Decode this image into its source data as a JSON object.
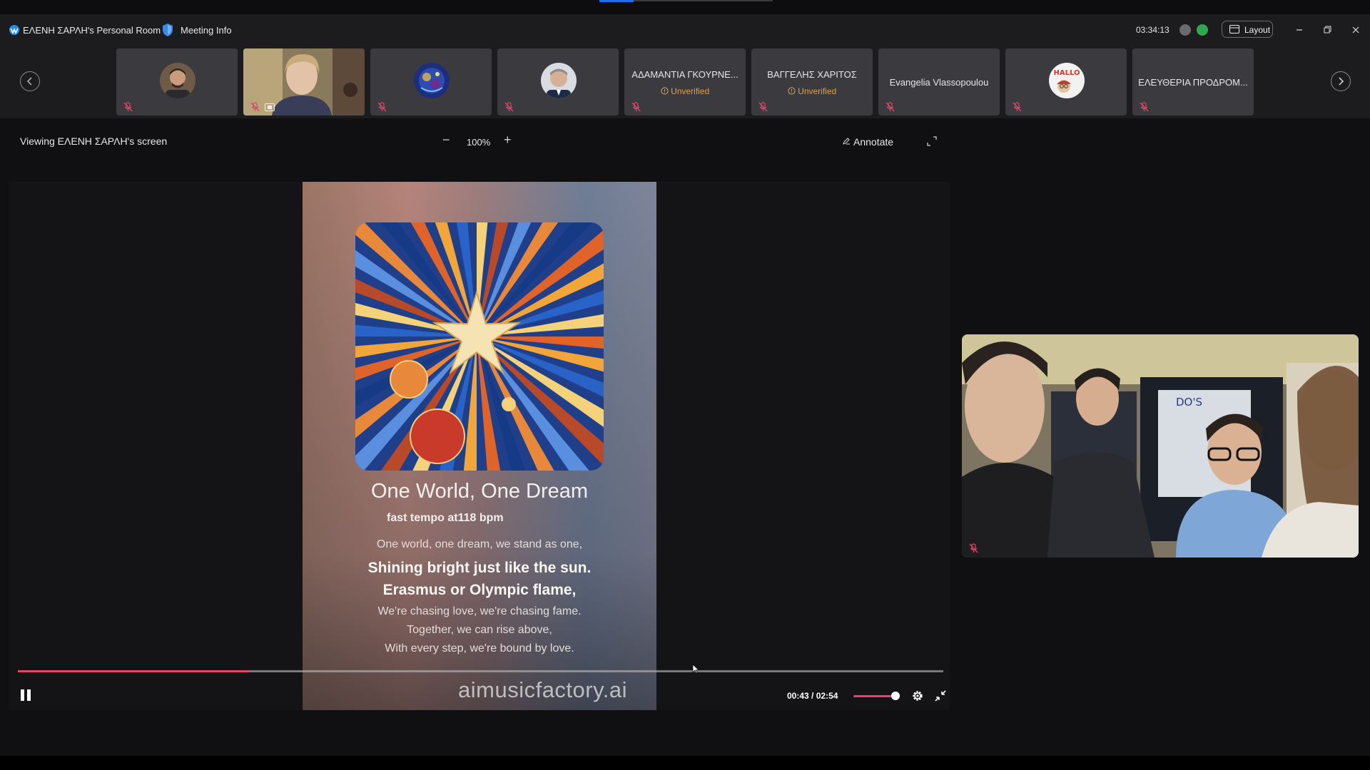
{
  "titlebar": {
    "room_title": "ΕΛΕΝΗ ΣΑΡΛΗ's Personal Room",
    "meeting_info": "Meeting Info",
    "clock": "03:34:13",
    "layout_label": "Layout"
  },
  "participants": [
    {
      "name": "",
      "unverified": "",
      "kind": "avatar-man"
    },
    {
      "name": "",
      "unverified": "",
      "kind": "video-woman"
    },
    {
      "name": "",
      "unverified": "",
      "kind": "avatar-space"
    },
    {
      "name": "",
      "unverified": "",
      "kind": "avatar-man2"
    },
    {
      "name": "ΑΔΑΜΑΝΤΙΑ ΓΚΟΥΡΝΕ...",
      "unverified": "Unverified",
      "kind": "name"
    },
    {
      "name": "ΒΑΓΓΕΛΗΣ ΧΑΡΙΤΟΣ",
      "unverified": "Unverified",
      "kind": "name"
    },
    {
      "name": "Evangelia Vlassopoulou",
      "unverified": "",
      "kind": "name"
    },
    {
      "name": "",
      "unverified": "",
      "kind": "avatar-hallo"
    },
    {
      "name": "ΕΛΕΥΘΕΡΙΑ ΠΡΟΔΡΟΜ...",
      "unverified": "",
      "kind": "name"
    }
  ],
  "share_toolbar": {
    "viewing": "Viewing ΕΛΕΝΗ ΣΑΡΛΗ's screen",
    "zoom": "100%",
    "annotate": "Annotate"
  },
  "poster": {
    "title": "One World, One Dream",
    "tempo": "fast tempo at118 bpm",
    "lyrics": [
      {
        "text": "One world, one dream, we stand as one,",
        "style": "s"
      },
      {
        "text": "Shining bright just like the sun.",
        "style": "b"
      },
      {
        "text": "Erasmus or Olympic flame,",
        "style": "b"
      },
      {
        "text": "We're chasing love, we're chasing fame.",
        "style": "s"
      },
      {
        "text": "Together, we can rise above,",
        "style": "s"
      },
      {
        "text": "With every step, we're bound by love.",
        "style": "s"
      }
    ]
  },
  "player": {
    "watermark": "aimusicfactory.ai",
    "current_time": "00:43",
    "duration": "02:54",
    "progress": 0.25,
    "volume": 1.0
  },
  "colors": {
    "accent": "#e0456b",
    "unverified": "#e1a04a",
    "status_green": "#2fa84f"
  }
}
